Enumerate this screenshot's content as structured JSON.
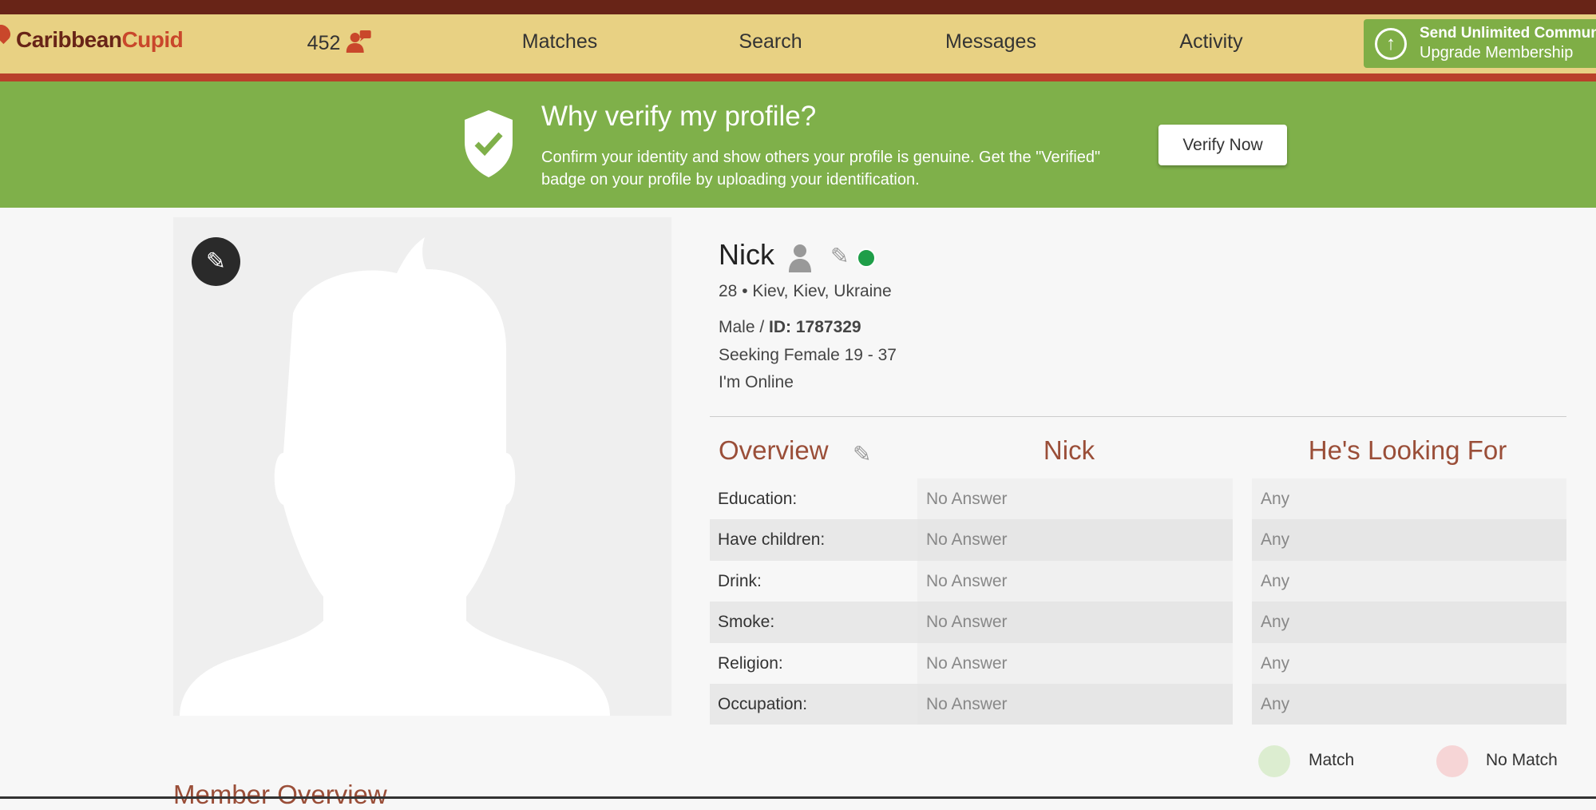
{
  "nav": {
    "logo_part1": "Caribbean",
    "logo_part2": "Cupid",
    "count": "452",
    "items": [
      "Matches",
      "Search",
      "Messages",
      "Activity"
    ],
    "upgrade": {
      "title": "Send Unlimited Communication",
      "subtitle": "Upgrade Membership"
    }
  },
  "banner": {
    "title": "Why verify my profile?",
    "text": "Confirm your identity and show others your profile is genuine. Get the \"Verified\" badge on your profile by uploading your identification.",
    "button": "Verify Now"
  },
  "profile": {
    "name": "Nick",
    "location": "28 • Kiev, Kiev, Ukraine",
    "gender": "Male / ",
    "id": "ID: 1787329",
    "seeking": "Seeking Female 19 - 37",
    "status": "I'm Online",
    "online_color": "#1e9e48"
  },
  "overview": {
    "title": "Overview",
    "col1": "Nick",
    "col2": "He's Looking For",
    "rows": [
      {
        "label": "Education:",
        "value": "No Answer",
        "looking": "Any"
      },
      {
        "label": "Have children:",
        "value": "No Answer",
        "looking": "Any"
      },
      {
        "label": "Drink:",
        "value": "No Answer",
        "looking": "Any"
      },
      {
        "label": "Smoke:",
        "value": "No Answer",
        "looking": "Any"
      },
      {
        "label": "Religion:",
        "value": "No Answer",
        "looking": "Any"
      },
      {
        "label": "Occupation:",
        "value": "No Answer",
        "looking": "Any"
      }
    ]
  },
  "legend": {
    "match": "Match",
    "no_match": "No Match",
    "match_color": "#dcedd0",
    "no_match_color": "#f6d5d6"
  },
  "member_overview": "Member Overview"
}
